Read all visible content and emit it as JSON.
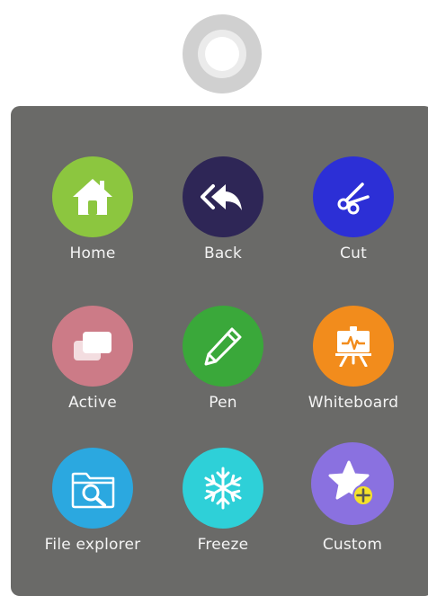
{
  "tiles": [
    {
      "id": "home",
      "label": "Home",
      "icon": "home-icon",
      "color": "#8cc63f"
    },
    {
      "id": "back",
      "label": "Back",
      "icon": "back-icon",
      "color": "#2e2656"
    },
    {
      "id": "cut",
      "label": "Cut",
      "icon": "scissors-icon",
      "color": "#2c2fd6"
    },
    {
      "id": "active",
      "label": "Active",
      "icon": "windows-icon",
      "color": "#cc7b87"
    },
    {
      "id": "pen",
      "label": "Pen",
      "icon": "pen-icon",
      "color": "#3aa83a"
    },
    {
      "id": "whiteboard",
      "label": "Whiteboard",
      "icon": "whiteboard-easel-icon",
      "color": "#f28c1c"
    },
    {
      "id": "file-explorer",
      "label": "File explorer",
      "icon": "folder-search-icon",
      "color": "#2ba8e0"
    },
    {
      "id": "freeze",
      "label": "Freeze",
      "icon": "snowflake-icon",
      "color": "#2ed0d8"
    },
    {
      "id": "custom",
      "label": "Custom",
      "icon": "star-add-icon",
      "color": "#8a71e0"
    }
  ]
}
